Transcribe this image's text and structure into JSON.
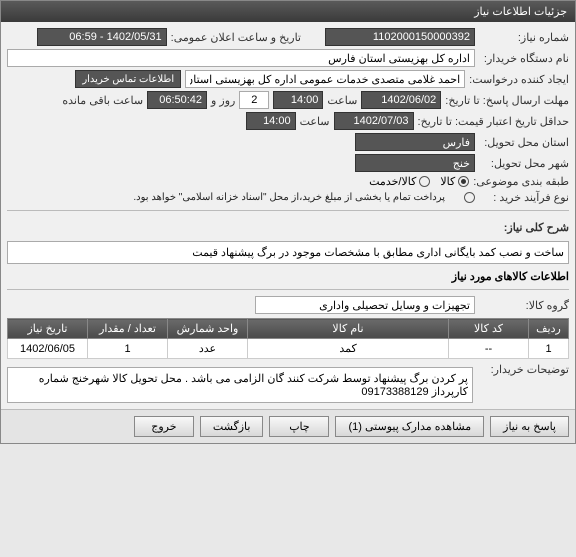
{
  "window": {
    "title": "جزئیات اطلاعات نیاز"
  },
  "fields": {
    "reqNoLabel": "شماره نیاز:",
    "reqNo": "1102000150000392",
    "announceLabel": "تاریخ و ساعت اعلان عمومی:",
    "announce": "1402/05/31 - 06:59",
    "buyerLabel": "نام دستگاه خریدار:",
    "buyer": "اداره کل بهزیستی استان فارس",
    "creatorLabel": "ایجاد کننده درخواست:",
    "creator": "احمد غلامی متصدی خدمات عمومی اداره کل بهزیستی استان فارس",
    "contactBtn": "اطلاعات تماس خریدار",
    "deadlineLabel": "مهلت ارسال پاسخ: تا تاریخ:",
    "deadlineDate": "1402/06/02",
    "timeLabel": "ساعت",
    "deadlineTime": "14:00",
    "daysLabel": "روز و",
    "days": "2",
    "remainTime": "06:50:42",
    "remainLabel": "ساعت باقی مانده",
    "validityLabel": "حداقل تاریخ اعتبار قیمت: تا تاریخ:",
    "validityDate": "1402/07/03",
    "validityTime": "14:00",
    "provinceLabel": "استان محل تحویل:",
    "province": "فارس",
    "cityLabel": "شهر محل تحویل:",
    "city": "خنج",
    "classLabel": "طبقه بندی موضوعی:",
    "classGoods": "کالا",
    "classService": "کالا/خدمت",
    "buyTypeLabel": "نوع فرآیند خرید :",
    "buyTypeOther": "",
    "noteText": "پرداخت تمام یا بخشی از مبلغ خرید،از محل \"اسناد خزانه اسلامی\" خواهد بود."
  },
  "summary": {
    "label": "شرح کلی نیاز:",
    "text": "ساخت و نصب کمد بایگانی اداری مطابق با مشخصات موجود در برگ پیشنهاد قیمت"
  },
  "goods": {
    "sectionTitle": "اطلاعات کالاهای مورد نیاز",
    "groupLabel": "گروه کالا:",
    "group": "تجهیزات و وسایل تحصیلی واداری"
  },
  "table": {
    "headers": {
      "row": "ردیف",
      "code": "کد کالا",
      "name": "نام کالا",
      "unit": "واحد شمارش",
      "qty": "تعداد / مقدار",
      "date": "تاریخ نیاز"
    },
    "rows": [
      {
        "row": "1",
        "code": "--",
        "name": "کمد",
        "unit": "عدد",
        "qty": "1",
        "date": "1402/06/05"
      }
    ]
  },
  "buyerDesc": {
    "label": "توضیحات خریدار:",
    "text": "پر کردن برگ پیشنهاد توسط شرکت کنند گان الزامی می باشد . محل تحویل کالا شهرخنج شماره کارپرداز 09173388129"
  },
  "buttons": {
    "respond": "پاسخ به نیاز",
    "attach": "مشاهده مدارک پیوستی (1)",
    "print": "چاپ",
    "back": "بازگشت",
    "exit": "خروج"
  }
}
